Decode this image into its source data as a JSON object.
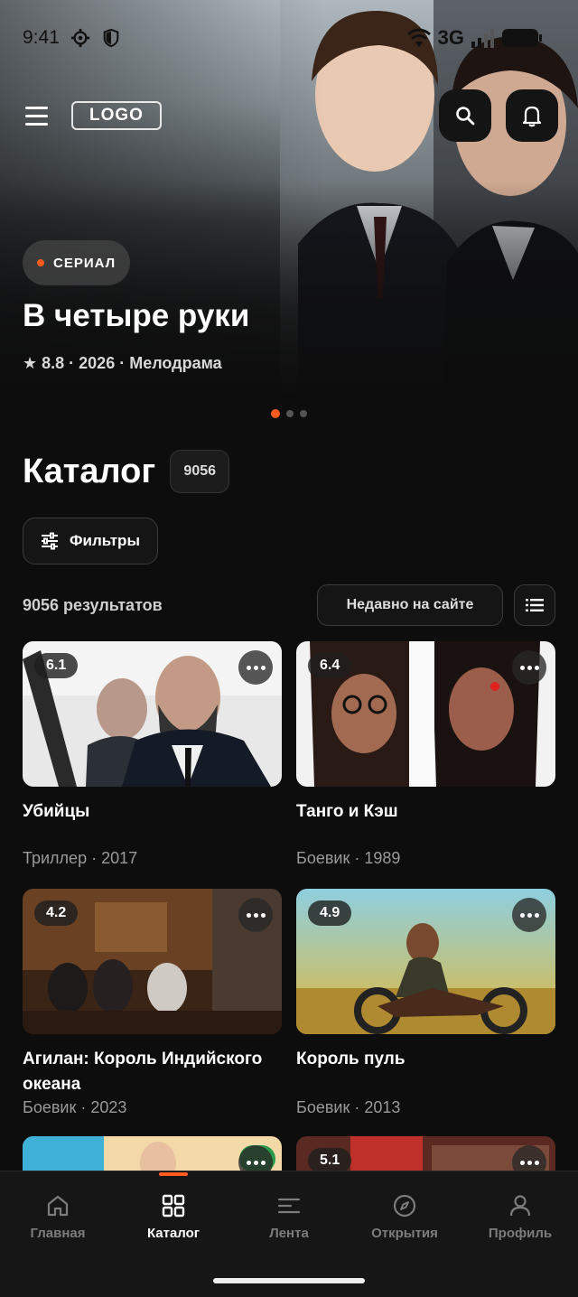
{
  "status_bar": {
    "time": "9:41",
    "network": "3G"
  },
  "header": {
    "logo": "LOGO"
  },
  "hero": {
    "badge": "СЕРИАЛ",
    "title": "В четыре руки",
    "meta": "★ 8.8 · 2026 · Мелодрама",
    "slides_total": 3,
    "active_slide": 1
  },
  "catalog": {
    "title": "Каталог",
    "count": "9056",
    "filters_label": "Фильтры",
    "results_label": "9056 результатов",
    "sort_label": "Недавно на сайте"
  },
  "cards": [
    {
      "rating": "6.1",
      "title": "Убийцы",
      "meta": "Триллер · 2017"
    },
    {
      "rating": "6.4",
      "title": "Танго и Кэш",
      "meta": "Боевик · 1989"
    },
    {
      "rating": "4.2",
      "title": "Агилан: Король Индийского океана",
      "meta": "Боевик · 2023"
    },
    {
      "rating": "4.9",
      "title": "Король пуль",
      "meta": "Боевик · 2013"
    },
    {
      "rating": "",
      "title": "",
      "meta": ""
    },
    {
      "rating": "5.1",
      "title": "",
      "meta": ""
    }
  ],
  "nav": [
    {
      "label": "Главная",
      "icon": "home-icon"
    },
    {
      "label": "Каталог",
      "icon": "grid-icon",
      "active": true
    },
    {
      "label": "Лента",
      "icon": "feed-icon"
    },
    {
      "label": "Открытия",
      "icon": "compass-icon"
    },
    {
      "label": "Профиль",
      "icon": "profile-icon"
    }
  ],
  "colors": {
    "accent": "#ff5a1f",
    "background": "#0d0d0d"
  }
}
